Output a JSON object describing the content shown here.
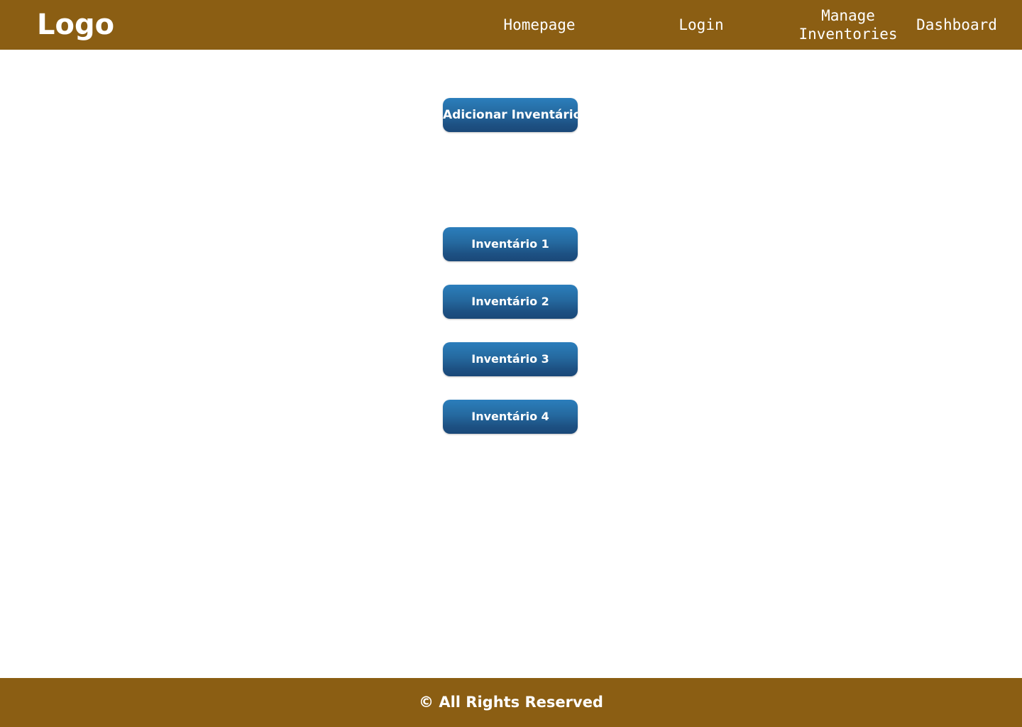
{
  "theme": {
    "header_background": "#8b5e13",
    "footer_background": "#8b5e13",
    "page_background": "#ffffff",
    "button_gradient_top": "#2b7ebc",
    "button_gradient_bottom": "#1a4878",
    "text_on_brand": "#ffffff"
  },
  "header": {
    "logo_text": "Logo",
    "nav": [
      {
        "label": "Homepage"
      },
      {
        "label": "Login"
      },
      {
        "label": "Manage\nInventories"
      },
      {
        "label": "Dashboard"
      }
    ]
  },
  "main": {
    "add_inventory_button": "Adicionar Inventário",
    "inventories": [
      {
        "label": "Inventário 1"
      },
      {
        "label": "Inventário 2"
      },
      {
        "label": "Inventário 3"
      },
      {
        "label": "Inventário 4"
      }
    ]
  },
  "footer": {
    "copyright": "© All Rights Reserved"
  }
}
